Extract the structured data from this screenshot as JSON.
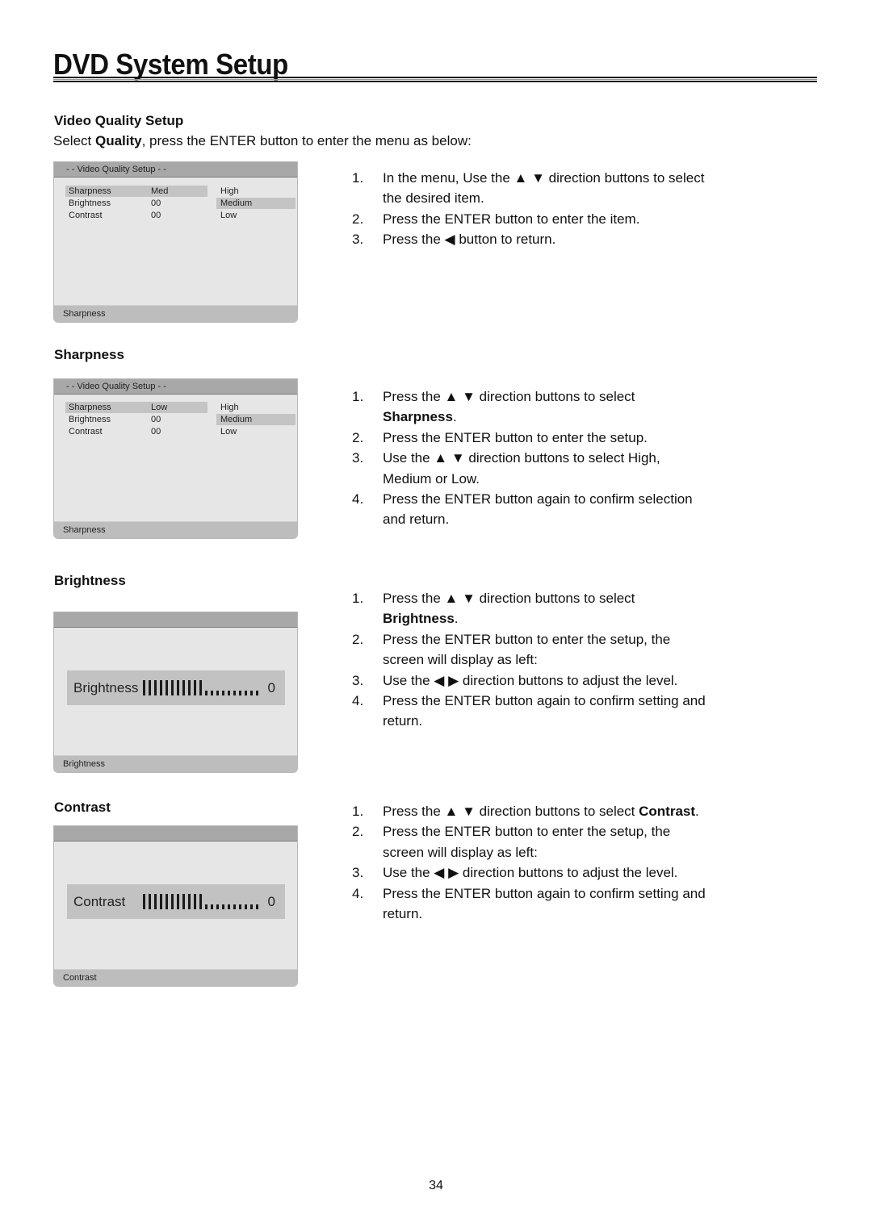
{
  "page": {
    "title": "DVD System Setup",
    "page_number": "34"
  },
  "video_quality": {
    "heading": "Video Quality Setup",
    "intro_prefix": "Select ",
    "intro_bold": "Quality",
    "intro_suffix": ", press the ENTER button to enter the menu as below:",
    "osd": {
      "header": "- - Video Quality Setup - -",
      "rows": [
        {
          "name": "Sharpness",
          "value": "Med",
          "selected": true
        },
        {
          "name": "Brightness",
          "value": "00",
          "selected": false
        },
        {
          "name": "Contrast",
          "value": "00",
          "selected": false
        }
      ],
      "options": [
        {
          "label": "High",
          "selected": false
        },
        {
          "label": "Medium",
          "selected": true
        },
        {
          "label": "Low",
          "selected": false
        }
      ],
      "footer": "Sharpness"
    },
    "steps": [
      {
        "n": "1.",
        "text": "In the menu, Use the ▲ ▼ direction buttons to select the desired item."
      },
      {
        "n": "2.",
        "text": "Press the ENTER button to enter the item."
      },
      {
        "n": "3.",
        "text": "Press the ◀ button to return."
      }
    ]
  },
  "sharpness": {
    "heading": "Sharpness",
    "osd": {
      "header": "- - Video Quality Setup - -",
      "rows": [
        {
          "name": "Sharpness",
          "value": "Low",
          "selected": true
        },
        {
          "name": "Brightness",
          "value": "00",
          "selected": false
        },
        {
          "name": "Contrast",
          "value": "00",
          "selected": false
        }
      ],
      "options": [
        {
          "label": "High",
          "selected": false
        },
        {
          "label": "Medium",
          "selected": true
        },
        {
          "label": "Low",
          "selected": false
        }
      ],
      "footer": "Sharpness"
    },
    "steps": [
      {
        "n": "1.",
        "pre": "Press the ▲ ▼ direction buttons to select ",
        "bold": "Sharpness",
        "post": "."
      },
      {
        "n": "2.",
        "pre": "Press the ENTER button to enter the setup.",
        "bold": "",
        "post": ""
      },
      {
        "n": "3.",
        "pre": "Use the ▲ ▼ direction buttons to select High, Medium or Low.",
        "bold": "",
        "post": ""
      },
      {
        "n": "4.",
        "pre": "Press the ENTER button again to confirm selection and return.",
        "bold": "",
        "post": ""
      }
    ]
  },
  "brightness": {
    "heading": "Brightness",
    "osd": {
      "label": "Brightness",
      "value": "0",
      "level_filled": 11,
      "level_total": 21,
      "footer": "Brightness"
    },
    "steps": [
      {
        "n": "1.",
        "pre": "Press the ▲ ▼ direction buttons to select ",
        "bold": "Brightness",
        "post": "."
      },
      {
        "n": "2.",
        "pre": "Press the ENTER button to enter the setup, the screen will display as left:",
        "bold": "",
        "post": ""
      },
      {
        "n": "3.",
        "pre": "Use the ◀ ▶ direction buttons to adjust the level.",
        "bold": "",
        "post": ""
      },
      {
        "n": "4.",
        "pre": "Press the ENTER button again to confirm setting and return.",
        "bold": "",
        "post": ""
      }
    ]
  },
  "contrast": {
    "heading": "Contrast",
    "osd": {
      "label": "Contrast",
      "value": "0",
      "level_filled": 11,
      "level_total": 21,
      "footer": "Contrast"
    },
    "steps": [
      {
        "n": "1.",
        "pre": "Press the ▲ ▼ direction buttons to select ",
        "bold": "Contrast",
        "post": "."
      },
      {
        "n": "2.",
        "pre": "Press the ENTER button to enter the setup, the screen will display as left:",
        "bold": "",
        "post": ""
      },
      {
        "n": "3.",
        "pre": "Use the ◀ ▶ direction buttons to adjust the level.",
        "bold": "",
        "post": ""
      },
      {
        "n": "4.",
        "pre": "Press the ENTER button again to confirm setting and return.",
        "bold": "",
        "post": ""
      }
    ]
  }
}
